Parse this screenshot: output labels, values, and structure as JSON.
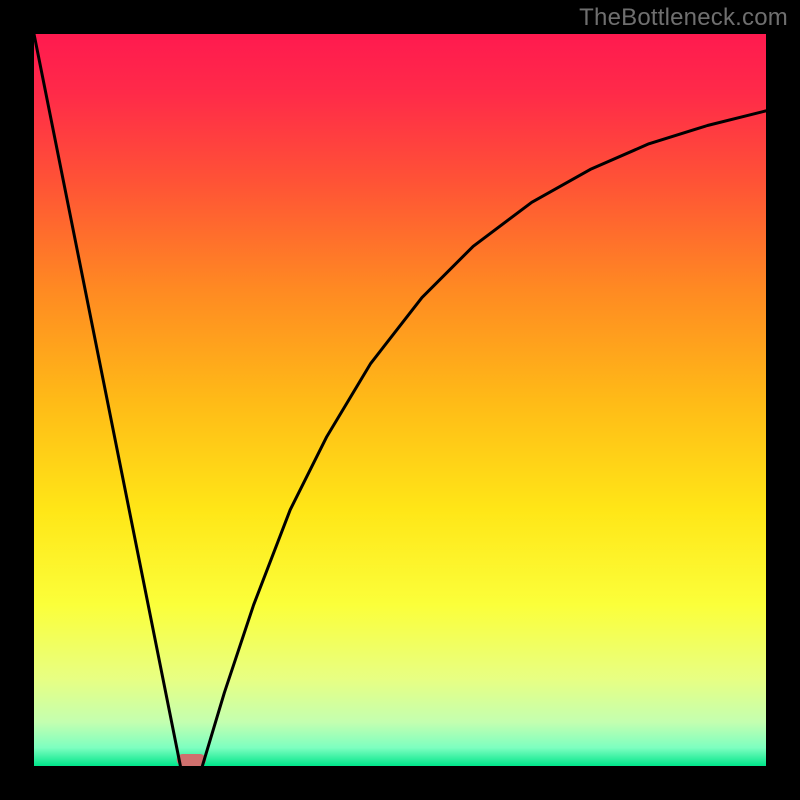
{
  "watermark": "TheBottleneck.com",
  "chart_data": {
    "type": "line",
    "title": "",
    "xlabel": "",
    "ylabel": "",
    "xlim": [
      0,
      100
    ],
    "ylim": [
      0,
      100
    ],
    "grid": false,
    "background_gradient": {
      "stops": [
        {
          "offset": 0.0,
          "color": "#ff1a4f"
        },
        {
          "offset": 0.08,
          "color": "#ff2a49"
        },
        {
          "offset": 0.2,
          "color": "#ff5236"
        },
        {
          "offset": 0.35,
          "color": "#ff8a22"
        },
        {
          "offset": 0.5,
          "color": "#ffba17"
        },
        {
          "offset": 0.65,
          "color": "#ffe617"
        },
        {
          "offset": 0.78,
          "color": "#fbff3a"
        },
        {
          "offset": 0.88,
          "color": "#e8ff82"
        },
        {
          "offset": 0.94,
          "color": "#c4ffb0"
        },
        {
          "offset": 0.975,
          "color": "#7dffc0"
        },
        {
          "offset": 1.0,
          "color": "#00e58a"
        }
      ]
    },
    "series": [
      {
        "name": "left-branch",
        "x": [
          0.0,
          4.0,
          8.0,
          12.0,
          16.0,
          18.5,
          20.0
        ],
        "y": [
          100.0,
          80.0,
          60.0,
          40.0,
          20.0,
          7.5,
          0.0
        ]
      },
      {
        "name": "right-branch",
        "x": [
          23.0,
          26.0,
          30.0,
          35.0,
          40.0,
          46.0,
          53.0,
          60.0,
          68.0,
          76.0,
          84.0,
          92.0,
          100.0
        ],
        "y": [
          0.0,
          10.0,
          22.0,
          35.0,
          45.0,
          55.0,
          64.0,
          71.0,
          77.0,
          81.5,
          85.0,
          87.5,
          89.5
        ]
      }
    ],
    "marker": {
      "name": "minimum-marker",
      "x": 21.5,
      "width": 4.0,
      "color": "#cf6f6d"
    }
  }
}
